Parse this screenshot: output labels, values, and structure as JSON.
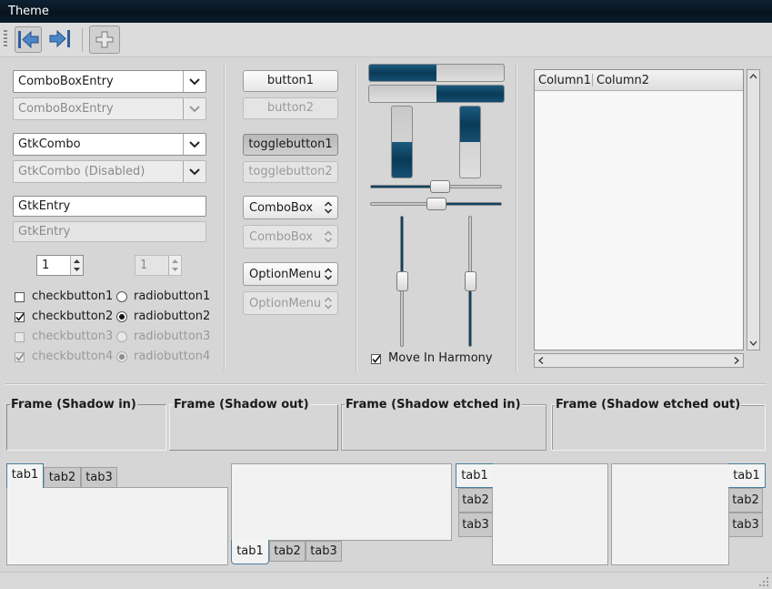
{
  "window": {
    "title": "Theme"
  },
  "toolbar": {
    "back_icon": "go-back-icon",
    "forward_icon": "go-forward-icon",
    "add_icon": "add-icon"
  },
  "col1": {
    "combo_entry": "ComboBoxEntry",
    "combo_entry_dis": "ComboBoxEntry",
    "gtkcombo": "GtkCombo",
    "gtkcombo_dis": "GtkCombo (Disabled)",
    "entry": "GtkEntry",
    "entry_dis": "GtkEntry",
    "spin": "1",
    "spin_dis": "1",
    "checks": [
      "checkbutton1",
      "checkbutton2",
      "checkbutton3",
      "checkbutton4"
    ],
    "radios": [
      "radiobutton1",
      "radiobutton2",
      "radiobutton3",
      "radiobutton4"
    ]
  },
  "col2": {
    "button1": "button1",
    "button2": "button2",
    "toggle1": "togglebutton1",
    "toggle2": "togglebutton2",
    "combobox": "ComboBox",
    "combobox_dis": "ComboBox",
    "optionmenu": "OptionMenu",
    "optionmenu_dis": "OptionMenu"
  },
  "col3": {
    "progress_h1": 0.5,
    "progress_h2": 0.5,
    "progress_v1": 0.5,
    "progress_v2": 0.5,
    "move_in_harmony": "Move In Harmony"
  },
  "tree": {
    "columns": [
      "Column1",
      "Column2"
    ]
  },
  "frames": [
    "Frame (Shadow in)",
    "Frame (Shadow out)",
    "Frame (Shadow etched in)",
    "Frame (Shadow etched out)"
  ],
  "tabs": [
    "tab1",
    "tab2",
    "tab3"
  ],
  "colors": {
    "accent": "#0c4464",
    "titlebar": "#0a1d2b"
  }
}
